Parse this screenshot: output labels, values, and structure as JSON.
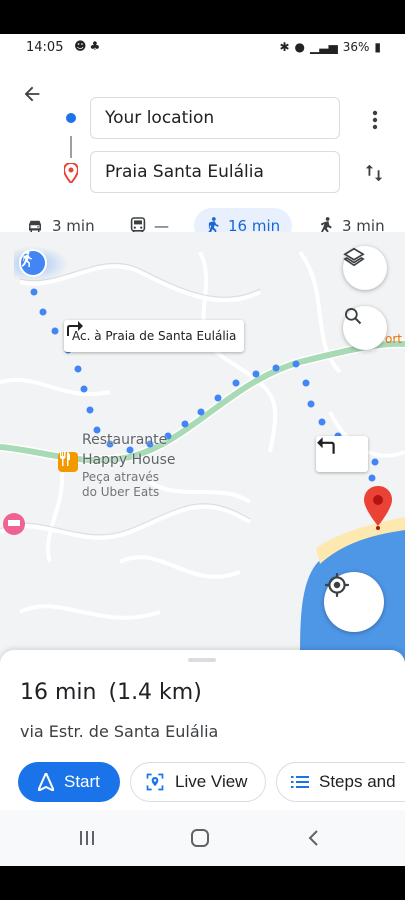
{
  "status": {
    "time": "14:05",
    "left_icons": [
      "whatsapp-icon",
      "fox-icon"
    ],
    "battery": "36%"
  },
  "directions": {
    "from": "Your location",
    "to": "Praia Santa Eulália"
  },
  "modes": [
    {
      "name": "car-icon",
      "value": "3 min",
      "active": false
    },
    {
      "name": "transit-icon",
      "value": "—",
      "active": false
    },
    {
      "name": "walk-icon",
      "value": "16 min",
      "active": true
    },
    {
      "name": "ride-icon",
      "value": "3 min",
      "active": false
    }
  ],
  "map": {
    "turn_label": "Ac. à Praia de Santa Eulália",
    "poi_name_1": "Restaurante",
    "poi_name_2": "Happy House",
    "poi_sub_1": "Peça através",
    "poi_sub_2": "do Uber Eats",
    "road_label": "ort"
  },
  "sheet": {
    "duration": "16 min",
    "distance": "(1.4 km)",
    "via": "via Estr. de Santa Eulália",
    "start_label": "Start",
    "live_view_label": "Live View",
    "steps_label": "Steps and"
  },
  "colors": {
    "accent": "#1a73e8",
    "route_green": "#a8dab5",
    "route_dots": "#4285f4",
    "pin_red": "#ea4335",
    "water": "#4e96e6",
    "beach": "#fde9b0"
  }
}
